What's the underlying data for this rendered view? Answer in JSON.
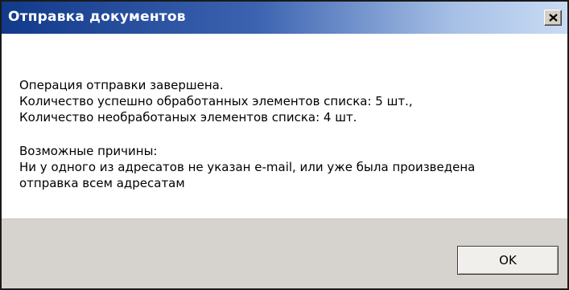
{
  "dialog": {
    "title": "Отправка документов",
    "close_icon": "close-icon",
    "message": {
      "line1": "Операция отправки завершена.",
      "line2": "Количество успешно обработанных элементов списка: 5 шт.,",
      "line3": "Количество необработаных элементов списка: 4 шт.",
      "line4": "Возможные причины:",
      "line5": "Ни у одного из адресатов не указан e-mail, или уже была произведена",
      "line6": "отправка всем адресатам"
    },
    "ok_label": "OK"
  },
  "colors": {
    "titlebar_start": "#123a8a",
    "titlebar_end": "#c9dbf3",
    "footer_bg": "#d6d3ce"
  }
}
